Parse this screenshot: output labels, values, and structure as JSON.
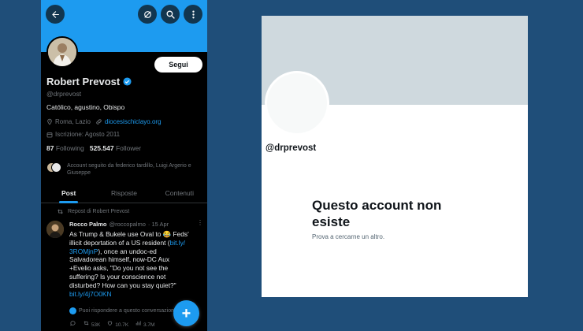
{
  "colors": {
    "brand_blue": "#1d9bf0",
    "background": "#1f4e79",
    "banner_gray": "#cfd9de"
  },
  "profile_screen": {
    "header": {
      "back_icon": "arrow-left-icon",
      "icons": [
        "repost-loop-icon",
        "search-icon",
        "more-vertical-icon"
      ]
    },
    "follow_label": "Segui",
    "name": "Robert Prevost",
    "verified_icon": "verified-badge-icon",
    "handle": "@drprevost",
    "bio": "Católico, agustino, Obispo",
    "location": "Roma, Lazio",
    "website": "diocesischiclayo.org",
    "joined": "Iscrizione: Agosto 2011",
    "following_count": "87",
    "following_label": "Following",
    "followers_count": "525.547",
    "followers_label": "Follower",
    "followed_by": "Account seguito da federico tardillo, Luigi Argerio e Giuseppe",
    "tabs": [
      "Post",
      "Risposte",
      "Contenuti"
    ],
    "active_tab": "Post",
    "tweet": {
      "repost_label": "Repost di Robert Prevost",
      "author_name": "Rocco Palmo",
      "author_handle": "@roccopalmo",
      "date": "· 15 Apr",
      "more": "⋮",
      "lines": [
        {
          "text": "As Trump & Bukele use Oval to 😂 Feds'"
        },
        {
          "text": "illicit deportation of a US resident (",
          "link": "bit.ly/",
          "after": ""
        },
        {
          "text": "",
          "link": "3ROMjnP",
          "after": "), once an undoc-ed"
        },
        {
          "text": "Salvadorean himself, now-DC Aux"
        },
        {
          "text": "+Evelio asks, \"Do you not see the"
        },
        {
          "text": "suffering? Is your conscience not"
        },
        {
          "text": "disturbed? How can you stay quiet?\""
        },
        {
          "text": "",
          "link": "bit.ly/4j7O0KN",
          "after": ""
        }
      ],
      "reply_note": "Puoi rispondere a questo conversazione",
      "actions": [
        {
          "icon": "reply-icon",
          "count": ""
        },
        {
          "icon": "repost-icon",
          "count": "53K"
        },
        {
          "icon": "like-icon",
          "count": "10.7K"
        },
        {
          "icon": "views-icon",
          "count": "3.7M"
        }
      ]
    },
    "fab_label": "+"
  },
  "missing_account": {
    "handle": "@drprevost",
    "title": "Questo account non esiste",
    "subtitle": "Prova a cercarne un altro."
  }
}
